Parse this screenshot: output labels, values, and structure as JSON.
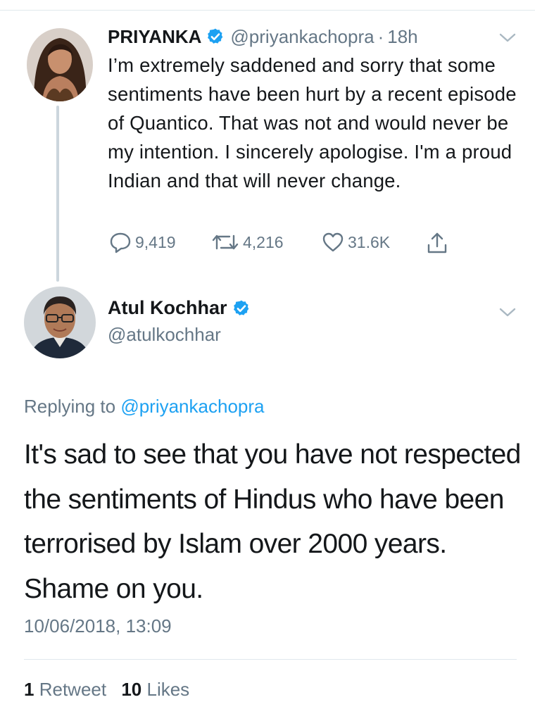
{
  "colors": {
    "brand_blue": "#1da1f2",
    "secondary_text": "#657786",
    "primary_text": "#14171a",
    "divider": "#e1e8ed"
  },
  "original_tweet": {
    "display_name": "PRIYANKA",
    "verified": true,
    "handle": "@priyankachopra",
    "separator": "·",
    "time": "18h",
    "text": "I’m extremely saddened and sorry that some sentiments have been hurt by a recent episode of Quantico. That was not and would never be my intention. I sincerely apologise. I'm a proud Indian and that will never change.",
    "actions": {
      "replies": "9,419",
      "retweets": "4,216",
      "likes": "31.6K",
      "icons": [
        "reply-icon",
        "retweet-icon",
        "like-icon",
        "share-icon"
      ]
    }
  },
  "reply_tweet": {
    "display_name": "Atul Kochhar",
    "verified": true,
    "handle": "@atulkochhar",
    "replying_prefix": "Replying to",
    "replying_to": "@priyankachopra",
    "text": "It's sad to see that you have not respected the sentiments of Hindus who have been terrorised by Islam over 2000 years. Shame on you.",
    "timestamp": "10/06/2018, 13:09",
    "stats": {
      "retweets_count": "1",
      "retweets_label": "Retweet",
      "likes_count": "10",
      "likes_label": "Likes"
    }
  }
}
